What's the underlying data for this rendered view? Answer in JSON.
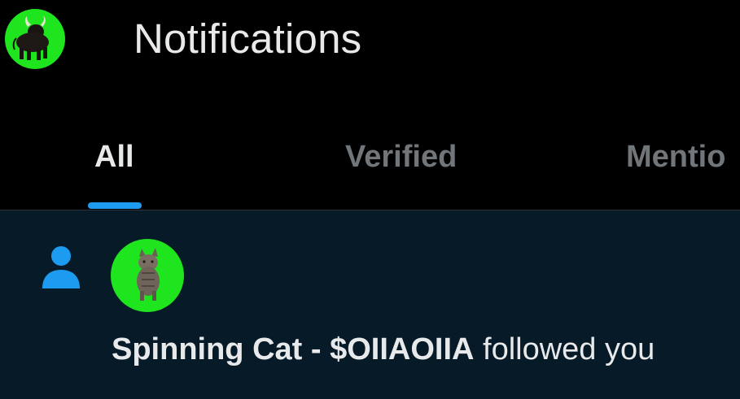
{
  "header": {
    "title": "Notifications",
    "avatar_icon": "bull-avatar-icon"
  },
  "tabs": [
    {
      "label": "All",
      "selected": true
    },
    {
      "label": "Verified",
      "selected": false
    },
    {
      "label": "Mentio",
      "selected": false
    }
  ],
  "notification": {
    "type_icon": "person-follow-icon",
    "avatar_icon": "cat-avatar-icon",
    "user_name": "Spinning Cat - $OIIAOIIA",
    "action": "followed you"
  },
  "colors": {
    "background": "#000000",
    "notification_bg": "#061a28",
    "accent": "#1d9bf0",
    "avatar_bg": "#1fe51f",
    "text_primary": "#e7e9ea",
    "text_secondary": "#71767b"
  }
}
